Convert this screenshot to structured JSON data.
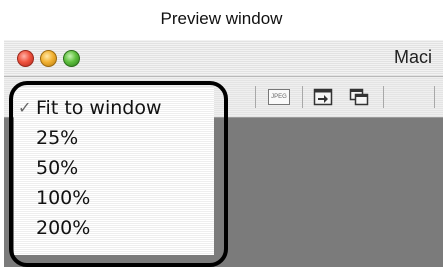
{
  "caption": "Preview window",
  "window": {
    "title": "Maci",
    "toolbar": {
      "jpeg_label": "JPEG"
    }
  },
  "zoom_menu": {
    "items": [
      {
        "label": "Fit to window",
        "checked": true
      },
      {
        "label": "25%",
        "checked": false
      },
      {
        "label": "50%",
        "checked": false
      },
      {
        "label": "100%",
        "checked": false
      },
      {
        "label": "200%",
        "checked": false
      }
    ],
    "check_glyph": "✓"
  },
  "colors": {
    "highlight_border": "#000000",
    "content_background": "#7b7b7b",
    "close_button": "#f0543f",
    "minimize_button": "#f2b233",
    "zoom_button": "#5fc03f"
  }
}
